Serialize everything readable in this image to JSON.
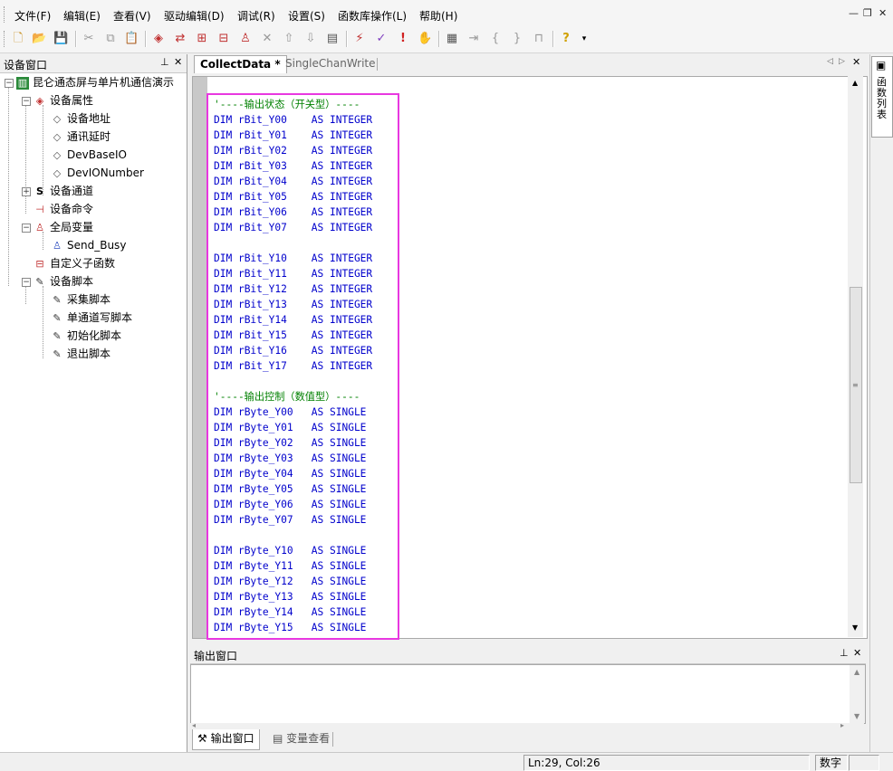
{
  "menu": [
    "文件(F)",
    "编辑(E)",
    "查看(V)",
    "驱动编辑(D)",
    "调试(R)",
    "设置(S)",
    "函数库操作(L)",
    "帮助(H)"
  ],
  "window_controls": [
    "×",
    "🗗",
    "×"
  ],
  "left_panel": {
    "title": "设备窗口",
    "tree": [
      {
        "label": "昆仑通态屏与单片机通信演示",
        "icon": "device-board-icon"
      },
      {
        "label": "设备属性",
        "icon": "property-icon"
      },
      {
        "label": "设备地址",
        "icon": "property-icon"
      },
      {
        "label": "通讯延时",
        "icon": "property-icon"
      },
      {
        "label": "DevBaseIO",
        "icon": "property-icon"
      },
      {
        "label": "DevIONumber",
        "icon": "property-icon"
      },
      {
        "label": "设备通道",
        "icon": "channel-icon"
      },
      {
        "label": "设备命令",
        "icon": "command-icon"
      },
      {
        "label": "全局变量",
        "icon": "variable-icon"
      },
      {
        "label": "Send_Busy",
        "icon": "variable-icon"
      },
      {
        "label": "自定义子函数",
        "icon": "function-icon"
      },
      {
        "label": "设备脚本",
        "icon": "script-icon"
      },
      {
        "label": "采集脚本",
        "icon": "script-icon"
      },
      {
        "label": "单通道写脚本",
        "icon": "script-icon"
      },
      {
        "label": "初始化脚本",
        "icon": "script-icon"
      },
      {
        "label": "退出脚本",
        "icon": "script-icon"
      }
    ]
  },
  "editor": {
    "tabs": [
      {
        "label": "CollectData *",
        "active": true
      },
      {
        "label": "SingleChanWrite",
        "active": false
      }
    ],
    "lines": [
      {
        "type": "comment",
        "text": "'----输出状态（开关型）----"
      },
      {
        "type": "dim",
        "name": "rBit_Y00",
        "vtype": "INTEGER"
      },
      {
        "type": "dim",
        "name": "rBit_Y01",
        "vtype": "INTEGER"
      },
      {
        "type": "dim",
        "name": "rBit_Y02",
        "vtype": "INTEGER"
      },
      {
        "type": "dim",
        "name": "rBit_Y03",
        "vtype": "INTEGER"
      },
      {
        "type": "dim",
        "name": "rBit_Y04",
        "vtype": "INTEGER"
      },
      {
        "type": "dim",
        "name": "rBit_Y05",
        "vtype": "INTEGER"
      },
      {
        "type": "dim",
        "name": "rBit_Y06",
        "vtype": "INTEGER"
      },
      {
        "type": "dim",
        "name": "rBit_Y07",
        "vtype": "INTEGER"
      },
      {
        "type": "blank"
      },
      {
        "type": "dim",
        "name": "rBit_Y10",
        "vtype": "INTEGER"
      },
      {
        "type": "dim",
        "name": "rBit_Y11",
        "vtype": "INTEGER"
      },
      {
        "type": "dim",
        "name": "rBit_Y12",
        "vtype": "INTEGER"
      },
      {
        "type": "dim",
        "name": "rBit_Y13",
        "vtype": "INTEGER"
      },
      {
        "type": "dim",
        "name": "rBit_Y14",
        "vtype": "INTEGER"
      },
      {
        "type": "dim",
        "name": "rBit_Y15",
        "vtype": "INTEGER"
      },
      {
        "type": "dim",
        "name": "rBit_Y16",
        "vtype": "INTEGER"
      },
      {
        "type": "dim",
        "name": "rBit_Y17",
        "vtype": "INTEGER"
      },
      {
        "type": "blank"
      },
      {
        "type": "comment",
        "text": "'----输出控制（数值型）----"
      },
      {
        "type": "dim",
        "name": "rByte_Y00",
        "vtype": "SINGLE"
      },
      {
        "type": "dim",
        "name": "rByte_Y01",
        "vtype": "SINGLE"
      },
      {
        "type": "dim",
        "name": "rByte_Y02",
        "vtype": "SINGLE"
      },
      {
        "type": "dim",
        "name": "rByte_Y03",
        "vtype": "SINGLE"
      },
      {
        "type": "dim",
        "name": "rByte_Y04",
        "vtype": "SINGLE"
      },
      {
        "type": "dim",
        "name": "rByte_Y05",
        "vtype": "SINGLE"
      },
      {
        "type": "dim",
        "name": "rByte_Y06",
        "vtype": "SINGLE"
      },
      {
        "type": "dim",
        "name": "rByte_Y07",
        "vtype": "SINGLE"
      },
      {
        "type": "blank"
      },
      {
        "type": "dim",
        "name": "rByte_Y10",
        "vtype": "SINGLE"
      },
      {
        "type": "dim",
        "name": "rByte_Y11",
        "vtype": "SINGLE"
      },
      {
        "type": "dim",
        "name": "rByte_Y12",
        "vtype": "SINGLE"
      },
      {
        "type": "dim",
        "name": "rByte_Y13",
        "vtype": "SINGLE"
      },
      {
        "type": "dim",
        "name": "rByte_Y14",
        "vtype": "SINGLE"
      },
      {
        "type": "dim",
        "name": "rByte_Y15",
        "vtype": "SINGLE"
      }
    ],
    "keyword_dim": "DIM",
    "keyword_as": "AS"
  },
  "right_rail": {
    "label": "函数列表"
  },
  "output_panel": {
    "title": "输出窗口",
    "tabs": [
      {
        "label": "输出窗口",
        "icon": "tools-icon"
      },
      {
        "label": "变量查看",
        "icon": "list-icon"
      }
    ]
  },
  "status": {
    "position": "Ln:29, Col:26",
    "mode": "数字"
  },
  "colors": {
    "highlight_border": "#e838e0",
    "keyword": "#0000cc",
    "comment": "#008000"
  }
}
